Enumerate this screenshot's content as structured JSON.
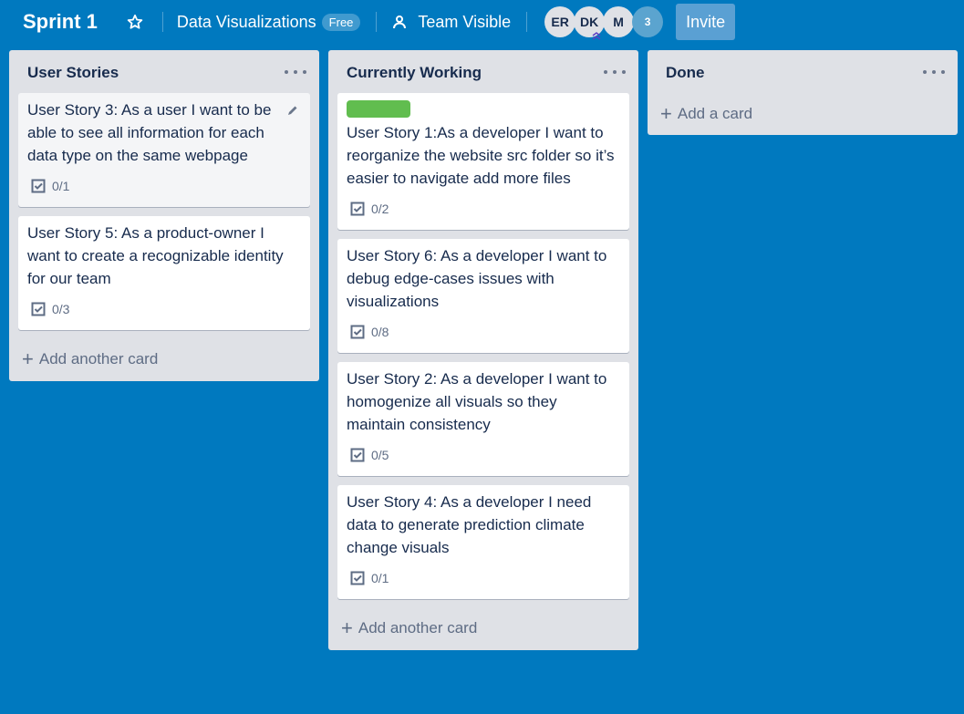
{
  "header": {
    "board_title": "Sprint 1",
    "team_name": "Data Visualizations",
    "team_badge": "Free",
    "visibility": "Team Visible",
    "members": [
      "ER",
      "DK",
      "M"
    ],
    "member_count": "3",
    "invite_label": "Invite"
  },
  "lists": [
    {
      "title": "User Stories",
      "cards": [
        {
          "text": "User Story 3: As a user I want to be able to see all information for each data type on the same webpage",
          "checklist": "0/1"
        },
        {
          "text": "User Story 5: As a product-owner I want to create a recognizable identity for our team",
          "checklist": "0/3"
        }
      ],
      "add_label": "Add another card"
    },
    {
      "title": "Currently Working",
      "cards": [
        {
          "text": "User Story 1:As a developer I want to reorganize the website src folder so it’s easier to navigate add more files",
          "checklist": "0/2",
          "label_color": "#61bd4f"
        },
        {
          "text": "User Story 6: As a developer I want to debug edge-cases issues with visualizations",
          "checklist": "0/8"
        },
        {
          "text": "User Story 2: As a developer I want to homogenize all visuals so they maintain consistency",
          "checklist": "0/5"
        },
        {
          "text": "User Story 4: As a developer I need data to generate prediction climate change visuals",
          "checklist": "0/1"
        }
      ],
      "add_label": "Add another card"
    },
    {
      "title": "Done",
      "cards": [],
      "add_label": "Add a card"
    }
  ],
  "colors": {
    "board_background": "#0079bf",
    "list_background": "#dfe1e6",
    "label_green": "#61bd4f"
  }
}
